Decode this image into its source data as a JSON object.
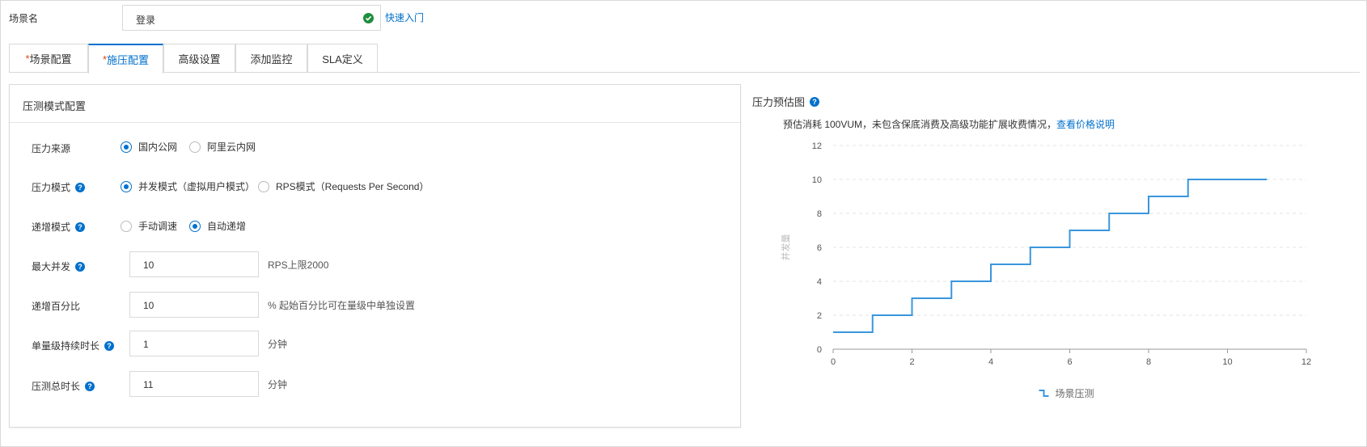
{
  "header": {
    "scene_name_label": "场景名",
    "scene_name_value": "登录",
    "quick_link": "快速入门"
  },
  "tabs": [
    {
      "required": "*",
      "label": "场景配置"
    },
    {
      "required": "*",
      "label": "施压配置"
    },
    {
      "required": "",
      "label": "高级设置"
    },
    {
      "required": "",
      "label": "添加监控"
    },
    {
      "required": "",
      "label": "SLA定义"
    }
  ],
  "active_tab": 1,
  "panel": {
    "title": "压测模式配置",
    "pressure_source": {
      "label": "压力来源",
      "options": [
        "国内公网",
        "阿里云内网"
      ],
      "selected": 0
    },
    "pressure_mode": {
      "label": "压力模式",
      "options": [
        "并发模式（虚拟用户模式）",
        "RPS模式（Requests Per Second）"
      ],
      "selected": 0
    },
    "ramp_mode": {
      "label": "递增模式",
      "options": [
        "手动调速",
        "自动递增"
      ],
      "selected": 1
    },
    "max_concurrency": {
      "label": "最大并发",
      "value": "10",
      "suffix": "RPS上限2000"
    },
    "ramp_percent": {
      "label": "递增百分比",
      "value": "10",
      "suffix": "% 起始百分比可在量级中单独设置"
    },
    "level_duration": {
      "label": "单量级持续时长",
      "value": "1",
      "suffix": "分钟"
    },
    "total_duration": {
      "label": "压测总时长",
      "value": "11",
      "suffix": "分钟"
    }
  },
  "chart_section": {
    "title": "压力预估图",
    "note_text": "预估消耗 100VUM，未包含保底消费及高级功能扩展收费情况，",
    "note_link": "查看价格说明"
  },
  "colors": {
    "accent": "#0070cc",
    "series": "#3a96dd",
    "success": "#1e8e3e"
  },
  "chart_data": {
    "type": "line",
    "step": true,
    "title": "",
    "xlabel": "",
    "ylabel": "并发量",
    "xlim": [
      0,
      12
    ],
    "ylim": [
      0,
      12
    ],
    "xticks": [
      0,
      2,
      4,
      6,
      8,
      10,
      12
    ],
    "yticks": [
      0,
      2,
      4,
      6,
      8,
      10,
      12
    ],
    "grid": true,
    "legend_position": "bottom-center",
    "series": [
      {
        "name": "场景压测",
        "x": [
          0,
          1,
          2,
          3,
          4,
          5,
          6,
          7,
          8,
          9,
          10,
          11
        ],
        "y": [
          1,
          2,
          3,
          4,
          5,
          6,
          7,
          8,
          9,
          10,
          10,
          10
        ]
      }
    ]
  }
}
